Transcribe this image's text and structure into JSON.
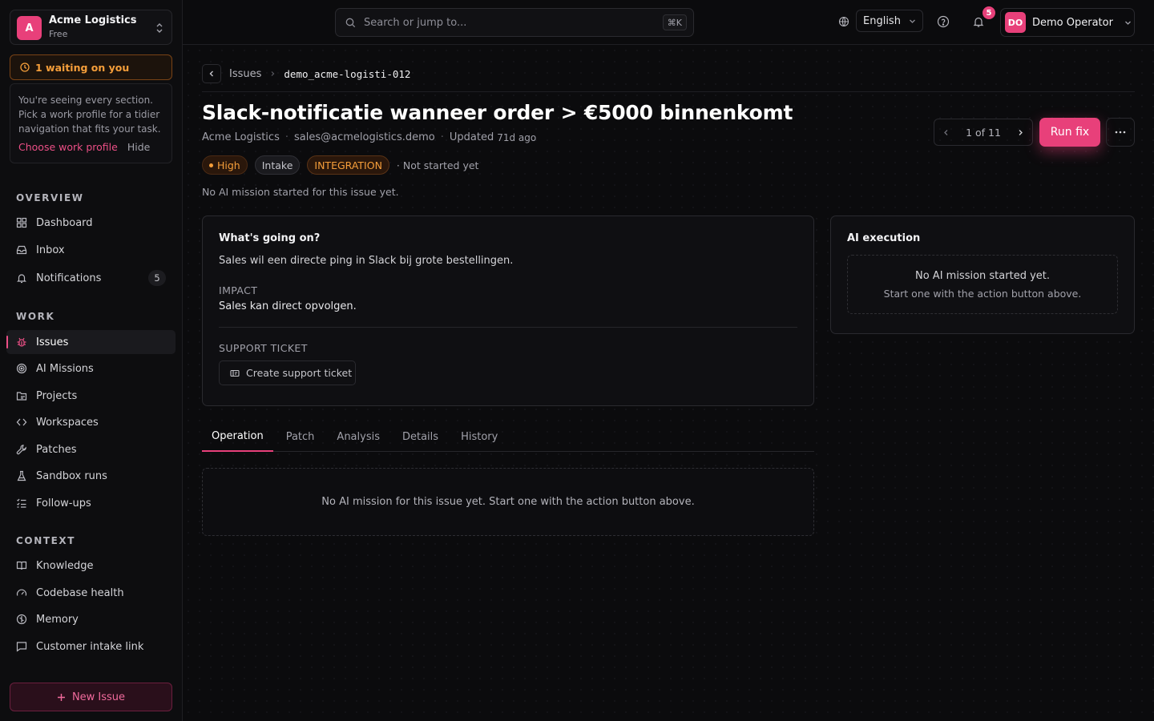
{
  "org": {
    "avatar": "A",
    "name": "Acme Logistics",
    "plan": "Free"
  },
  "waiting": {
    "text": "1 waiting on you"
  },
  "hint": {
    "text": "You're seeing every section. Pick a work profile for a tidier navigation that fits your task.",
    "choose": "Choose work profile",
    "hide": "Hide"
  },
  "sidebar": {
    "overview_label": "OVERVIEW",
    "overview": [
      {
        "label": "Dashboard",
        "icon": "dashboard-icon"
      },
      {
        "label": "Inbox",
        "icon": "inbox-icon"
      },
      {
        "label": "Notifications",
        "icon": "bell-icon",
        "badge": "5"
      }
    ],
    "work_label": "WORK",
    "work": [
      {
        "label": "Issues",
        "icon": "bug-icon",
        "active": true
      },
      {
        "label": "AI Missions",
        "icon": "target-icon"
      },
      {
        "label": "Projects",
        "icon": "projects-icon"
      },
      {
        "label": "Workspaces",
        "icon": "code-icon"
      },
      {
        "label": "Patches",
        "icon": "wrench-icon"
      },
      {
        "label": "Sandbox runs",
        "icon": "flask-icon"
      },
      {
        "label": "Follow-ups",
        "icon": "list-check-icon"
      }
    ],
    "context_label": "CONTEXT",
    "context": [
      {
        "label": "Knowledge",
        "icon": "book-icon"
      },
      {
        "label": "Codebase health",
        "icon": "gauge-icon"
      },
      {
        "label": "Memory",
        "icon": "brain-icon"
      },
      {
        "label": "Customer intake link",
        "icon": "message-icon"
      }
    ],
    "new_issue": "New Issue"
  },
  "topbar": {
    "search_placeholder": "Search or jump to...",
    "shortcut": "⌘K",
    "language": "English",
    "notif_count": "5",
    "user_initials": "DO",
    "user_name": "Demo Operator"
  },
  "breadcrumb": {
    "parent": "Issues",
    "current": "demo_acme-logisti-012"
  },
  "issue": {
    "title": "Slack-notificatie wanneer order > €5000 binnenkomt",
    "customer": "Acme Logistics",
    "email": "sales@acmelogistics.demo",
    "updated_label": "Updated",
    "updated_value": "71d ago",
    "priority": "High",
    "stage": "Intake",
    "category": "INTEGRATION",
    "status": "Not started yet",
    "mission_note": "No AI mission started for this issue yet."
  },
  "pager": {
    "text": "1 of 11"
  },
  "actions": {
    "run_fix": "Run fix"
  },
  "details": {
    "title": "What's going on?",
    "description": "Sales wil een directe ping in Slack bij grote bestellingen.",
    "impact_label": "IMPACT",
    "impact": "Sales kan direct opvolgen.",
    "ticket_label": "SUPPORT TICKET",
    "ticket_button": "Create support ticket"
  },
  "ai_execution": {
    "title": "AI execution",
    "empty_line1": "No AI mission started yet.",
    "empty_line2": "Start one with the action button above."
  },
  "tabs": [
    "Operation",
    "Patch",
    "Analysis",
    "Details",
    "History"
  ],
  "operation": {
    "empty": "No AI mission for this issue yet. Start one with the action button above."
  },
  "colors": {
    "accent": "#e8407a",
    "warning": "#f59e3a",
    "background": "#0b0b0d"
  }
}
